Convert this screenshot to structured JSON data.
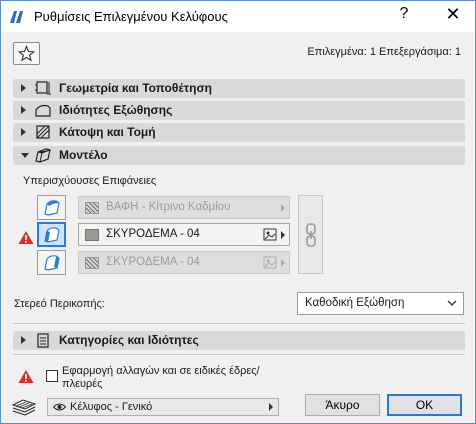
{
  "window": {
    "title": "Ρυθμίσεις Επιλεγμένου Κελύφους",
    "help_glyph": "?",
    "close_glyph": "✕"
  },
  "header": {
    "favorite_icon": "star-icon",
    "selection_info": "Επιλεγμένα: 1 Επεξεργάσιμα: 1"
  },
  "sections": [
    {
      "label": "Γεωμετρία και Τοποθέτηση",
      "expanded": false,
      "icon": "geometry-icon"
    },
    {
      "label": "Ιδιότητες Εξώθησης",
      "expanded": false,
      "icon": "extrusion-icon"
    },
    {
      "label": "Κάτοψη και Τομή",
      "expanded": false,
      "icon": "floor-plan-icon"
    },
    {
      "label": "Μοντέλο",
      "expanded": true,
      "icon": "model-icon"
    }
  ],
  "model": {
    "override_label": "Υπερισχύουσες Επιφάνειες",
    "surfaces": [
      {
        "text": "ΒΑΦΗ - Κίτρινο Καδμίου",
        "enabled": false,
        "swatch": "hatch",
        "has_material_icon": false
      },
      {
        "text": "ΣΚΥΡΟΔΕΜΑ - 04",
        "enabled": true,
        "swatch": "solid",
        "swatch_color": "#9a9a92",
        "has_material_icon": true
      },
      {
        "text": "ΣΚΥΡΟΔΕΜΑ - 04",
        "enabled": false,
        "swatch": "hatch",
        "has_material_icon": true
      }
    ],
    "stereo_label": "Στερεό Περικοπής:",
    "stereo_value": "Καθοδική Εξώθηση"
  },
  "categories_section": {
    "label": "Κατηγορίες και Ιδιότητες",
    "expanded": false,
    "icon": "list-icon"
  },
  "footer": {
    "apply_label": "Εφαρμογή αλλαγών και σε ειδικές έδρες/πλευρές",
    "apply_checked": false,
    "view_value": "Κέλυφος - Γενικό",
    "cancel_label": "Άκυρο",
    "ok_label": "OK"
  },
  "colors": {
    "accent": "#2a7bd8",
    "section_bg": "#d9d9d9",
    "warning": "#d9302c"
  }
}
